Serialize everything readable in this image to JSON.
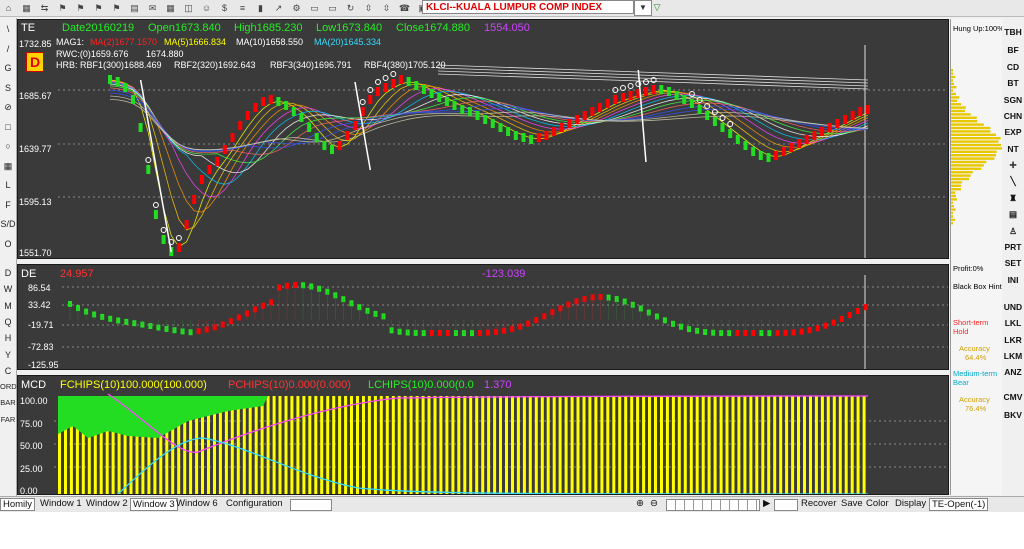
{
  "toolbar": {
    "icons": [
      "home-icon",
      "tiles-icon",
      "arrows-icon",
      "flag-icon",
      "flag-icon",
      "flag-icon",
      "flag-icon",
      "doc-icon",
      "chat-icon",
      "grid-icon",
      "window-icon",
      "user-icon",
      "money-icon",
      "list-icon",
      "barchart-icon",
      "chart-icon",
      "gear-icon",
      "folder-icon",
      "folder-icon",
      "redo-icon",
      "scroll-icon",
      "scroll-icon",
      "phone-icon",
      "box-icon",
      "paste-icon"
    ],
    "title": "KLCI--KUALA LUMPUR COMP INDEX"
  },
  "left_sidebar": {
    "upper": [
      "\\",
      "/",
      "G",
      "S",
      "⊘",
      "□",
      "○",
      "▦",
      "L",
      "F",
      "S/D",
      "O"
    ],
    "lower": [
      "D",
      "W",
      "M",
      "Q",
      "H",
      "Y",
      "C",
      "ORD",
      "BAR",
      "FAR"
    ]
  },
  "panel1": {
    "label": "TE",
    "date": "Date20160219",
    "open": "Open1673.840",
    "high": "High1685.230",
    "low": "Low1673.840",
    "close": "Close1674.880",
    "extra": "1554.050",
    "mag_label": "MAG1:",
    "ma_a": "MA(2)1677.1570",
    "ma5": "MA(5)1666.834",
    "ma10": "MA(10)1658.550",
    "ma20": "MA(20)1645.334",
    "rwc": "RWC:(0)1659.676",
    "rwc2": "1674.880",
    "hrb": "HRB:",
    "rbf1": "RBF1(300)1688.469",
    "rbf2": "RBF2(320)1692.643",
    "rbf3": "RBF3(340)1696.791",
    "rbf4": "RBF4(380)1705.120",
    "badge": "D",
    "yticks": [
      "1732.85",
      "1685.67",
      "1639.77",
      "1595.13",
      "1551.70"
    ]
  },
  "panel2": {
    "label": "DE",
    "left_value": "24.957",
    "center_value": "-123.039",
    "yticks": [
      "86.54",
      "33.42",
      "-19.71",
      "-72.83",
      "-125.95"
    ]
  },
  "panel3": {
    "label": "MCD",
    "fchips": "FCHIPS(10)100.000(100.000)",
    "pchips": "PCHIPS(10)0.000(0.000)",
    "lchips": "LCHIPS(10)0.000(0.0",
    "lchips_val": "1.370",
    "yticks": [
      "100.00",
      "75.00",
      "50.00",
      "25.00",
      "0.00"
    ]
  },
  "right_panel": {
    "hung_up": "Hung Up:100%",
    "profit": "Profit:0%",
    "black_box": "Black Box Hint",
    "short_term": "Short-term Hold",
    "accuracy1_label": "Accuracy",
    "accuracy1": "64.4%",
    "medium_term": "Medium-term Bear",
    "accuracy2_label": "Accuracy",
    "accuracy2": "76.4%"
  },
  "right_buttons": [
    "TBH",
    "BF",
    "CD",
    "BT",
    "SGN",
    "CHN",
    "EXP",
    "NT",
    "✛",
    "╲",
    "♜",
    "▤",
    "♙",
    "PRT",
    "SET",
    "INI",
    "UND",
    "LKL",
    "LKR",
    "LKM",
    "ANZ",
    "CMV",
    "BKV"
  ],
  "status_bar": {
    "left": "Homily",
    "windows": [
      "Window 1",
      "Window 2",
      "Window 3",
      "Window 6"
    ],
    "configuration": "Configuration",
    "recover": "Recover",
    "save": "Save",
    "color": "Color",
    "display": "Display",
    "mode": "TE-Open(-1)"
  },
  "colors": {
    "bg": "#3a3a3a",
    "up": "#ff0000",
    "down": "#22dd22",
    "text_green": "#22ee22",
    "yellow": "#ffff00",
    "magenta": "#ff44ff"
  }
}
